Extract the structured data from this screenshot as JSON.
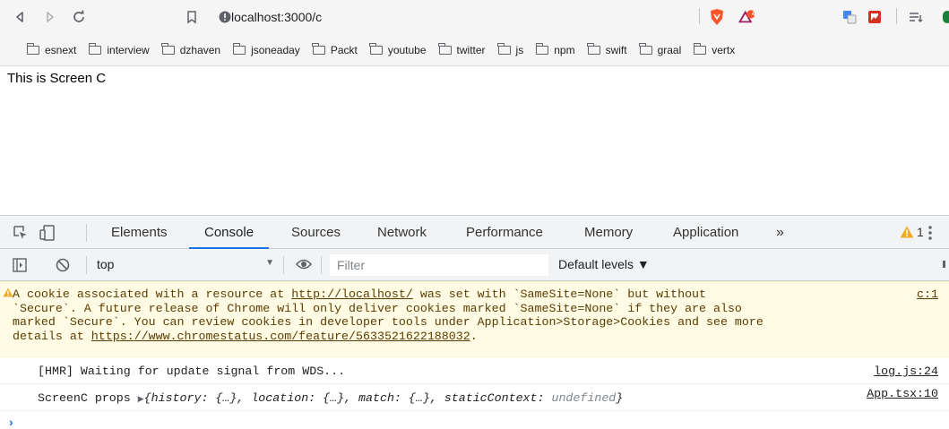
{
  "browser": {
    "url": "localhost:3000/c",
    "brave_badge_count": "4"
  },
  "bookmarks": [
    "esnext",
    "interview",
    "dzhaven",
    "jsoneaday",
    "Packt",
    "youtube",
    "twitter",
    "js",
    "npm",
    "swift",
    "graal",
    "vertx"
  ],
  "page": {
    "text": "This is Screen C"
  },
  "devtools": {
    "tabs": [
      "Elements",
      "Console",
      "Sources",
      "Network",
      "Performance",
      "Memory",
      "Application"
    ],
    "active_tab": "Console",
    "more_tabs": "»",
    "warning_count": "1",
    "context": "top",
    "filter_placeholder": "Filter",
    "levels": "Default levels ▼"
  },
  "console": {
    "warning": {
      "line1_a": "A cookie associated with a resource at ",
      "link1": "http://localhost/",
      "line1_b": " was set with `SameSite=None` but without",
      "line2": "`Secure`. A future release of Chrome will only deliver cookies marked `SameSite=None` if they are also",
      "line3": "marked `Secure`. You can review cookies in developer tools under Application>Storage>Cookies and see more",
      "line4_a": "details at ",
      "link2": "https://www.chromestatus.com/feature/5633521622188032",
      "line4_b": ".",
      "source": "c:1"
    },
    "hmr": {
      "text": "[HMR] Waiting for update signal from WDS...",
      "source": "log.js:24"
    },
    "props": {
      "label": "ScreenC props ",
      "arrow": "▶",
      "obj_open": "{history: {…}, location: {…}, match: {…}, staticContext: ",
      "undef": "undefined",
      "obj_close": "}",
      "source": "App.tsx:10"
    },
    "prompt": "›"
  },
  "colors": {
    "accent": "#1a73e8",
    "warning_bg": "#fffbe5",
    "warning_text": "#5c3c00",
    "warning_icon": "#f2ab26"
  }
}
